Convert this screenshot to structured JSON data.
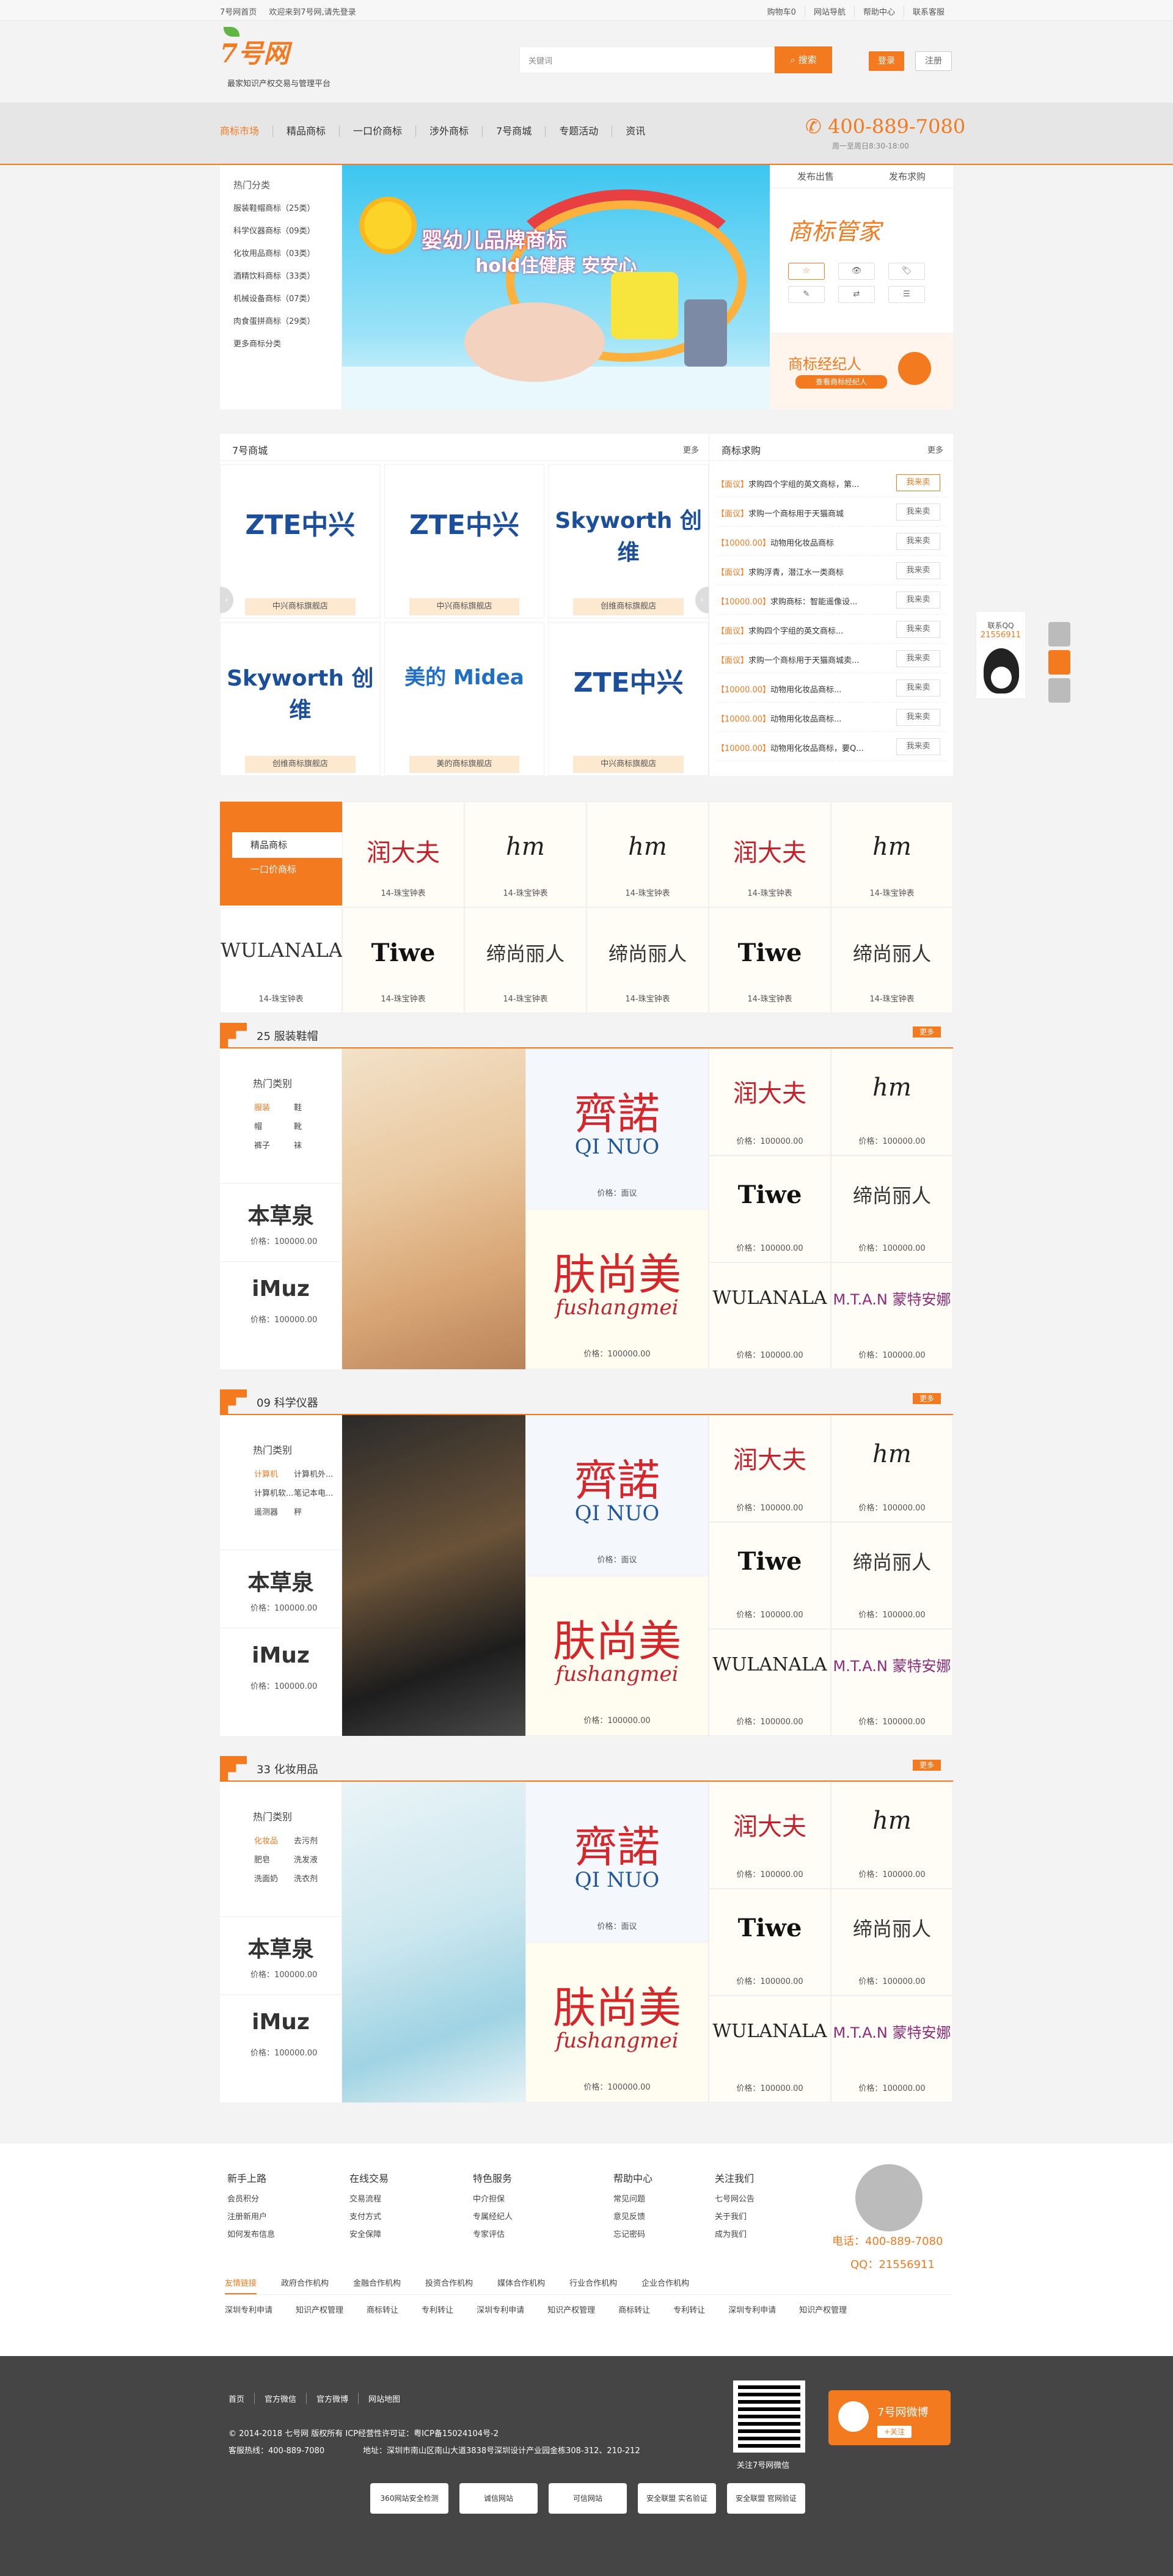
{
  "topbar": {
    "links_left": [
      "7号网首页",
      "欢迎来到7号网,请先登录"
    ],
    "links_right": [
      "购物车0",
      "网站导航",
      "帮助中心",
      "联系客服"
    ]
  },
  "header": {
    "logo": "7号网",
    "slogan": "最家知识产权交易与管理平台",
    "search_placeholder": "关键词",
    "search_btn": "搜索",
    "login": "登录",
    "register": "注册"
  },
  "nav": {
    "items": [
      "商标市场",
      "精品商标",
      "一口价商标",
      "涉外商标",
      "7号商城",
      "专题活动",
      "资讯"
    ],
    "phone": "400-889-7080",
    "hours": "周一至周日8:30-18:00"
  },
  "categories": {
    "title": "热门分类",
    "items": [
      "服装鞋帽商标（25类）",
      "科学仪器商标（09类）",
      "化妆用品商标（03类）",
      "酒精饮料商标（33类）",
      "机械设备商标（07类）",
      "肉食蛋拼商标（29类）",
      "更多商标分类"
    ]
  },
  "banner": {
    "l1": "婴幼儿品牌商标",
    "l2": "hold住健康 安安心"
  },
  "publish": {
    "tab1": "发布出售",
    "tab2": "发布求购",
    "logo": "商标管家",
    "icons": [
      "☆",
      "👁",
      "🏷",
      "✎",
      "⇄",
      "☰"
    ],
    "agent_title": "商标经纪人",
    "agent_btn": "查看商标经纪人"
  },
  "shop": {
    "title": "7号商城",
    "more": "更多",
    "items": [
      {
        "logo": "ZTE中兴",
        "caption": "中兴商标旗舰店"
      },
      {
        "logo": "ZTE中兴",
        "caption": "中兴商标旗舰店"
      },
      {
        "logo": "Skyworth 创维",
        "caption": "创维商标旗舰店"
      },
      {
        "logo": "Skyworth 创维",
        "caption": "创维商标旗舰店"
      },
      {
        "logo": "美的 Midea",
        "caption": "美的商标旗舰店"
      },
      {
        "logo": "ZTE中兴",
        "caption": "中兴商标旗舰店"
      }
    ]
  },
  "requests": {
    "title": "商标求购",
    "more": "更多",
    "rows": [
      {
        "tag": "【面议】",
        "text": "求购四个字组的英文商标，第...",
        "btn": "我来卖"
      },
      {
        "tag": "【面议】",
        "text": "求购一个商标用于天猫商城",
        "btn": "我来卖"
      },
      {
        "tag": "【10000.00】",
        "text": "动物用化妆品商标",
        "btn": "我来卖"
      },
      {
        "tag": "【面议】",
        "text": "求购浮青，潜江水一类商标",
        "btn": "我来卖"
      },
      {
        "tag": "【10000.00】",
        "text": "求购商标：智能遥像设...",
        "btn": "我来卖"
      },
      {
        "tag": "【面议】",
        "text": "求购四个字组的英文商标...",
        "btn": "我来卖"
      },
      {
        "tag": "【面议】",
        "text": "求购一个商标用于天猫商城卖...",
        "btn": "我来卖"
      },
      {
        "tag": "【10000.00】",
        "text": "动物用化妆品商标...",
        "btn": "我来卖"
      },
      {
        "tag": "【10000.00】",
        "text": "动物用化妆品商标...",
        "btn": "我来卖"
      },
      {
        "tag": "【10000.00】",
        "text": "动物用化妆品商标，要Q...",
        "btn": "我来卖"
      }
    ]
  },
  "float_qq": {
    "label": "联系QQ",
    "number": "21556911"
  },
  "boutique": {
    "tab1": "精品商标",
    "tab2": "一口价商标",
    "cells": [
      {
        "logo": "润大夫",
        "caption": "14-珠宝钟表"
      },
      {
        "logo": "hm",
        "caption": "14-珠宝钟表"
      },
      {
        "logo": "hm",
        "caption": "14-珠宝钟表"
      },
      {
        "logo": "润大夫",
        "caption": "14-珠宝钟表"
      },
      {
        "logo": "hm",
        "caption": "14-珠宝钟表"
      },
      {
        "logo": "WULANALA",
        "caption": "14-珠宝钟表"
      },
      {
        "logo": "Tiwe",
        "caption": "14-珠宝钟表"
      },
      {
        "logo": "缔尚丽人",
        "caption": "14-珠宝钟表"
      },
      {
        "logo": "缔尚丽人",
        "caption": "14-珠宝钟表"
      },
      {
        "logo": "Tiwe",
        "caption": "14-珠宝钟表"
      },
      {
        "logo": "缔尚丽人",
        "caption": "14-珠宝钟表"
      }
    ]
  },
  "floors": [
    {
      "num": "25",
      "title": "服装鞋帽",
      "more": "更多",
      "hot_title": "热门类别",
      "hot": [
        "服装",
        "鞋",
        "帽",
        "靴",
        "裤子",
        "袜"
      ],
      "mini": [
        {
          "logo": "本草泉",
          "price": "价格：100000.00"
        },
        {
          "logo": "iMuz",
          "price": "价格：100000.00"
        }
      ],
      "big": [
        {
          "logo": "齊諾",
          "sub": "QI NUO",
          "price": "价格：面议"
        },
        {
          "logo": "肤尚美",
          "sub": "fushangmei",
          "price": "价格：100000.00"
        }
      ],
      "small": [
        {
          "logo": "润大夫",
          "price": "价格：100000.00"
        },
        {
          "logo": "hm",
          "price": "价格：100000.00"
        },
        {
          "logo": "Tiwe",
          "price": "价格：100000.00"
        },
        {
          "logo": "缔尚丽人",
          "price": "价格：100000.00"
        },
        {
          "logo": "WULANALA",
          "price": "价格：100000.00"
        },
        {
          "logo": "M.T.A.N 蒙特安娜",
          "price": "价格：100000.00"
        }
      ]
    },
    {
      "num": "09",
      "title": "科学仪器",
      "more": "更多",
      "hot_title": "热门类别",
      "hot": [
        "计算机",
        "计算机外...",
        "计算机软...",
        "笔记本电...",
        "遥测器",
        "秤"
      ],
      "mini": [
        {
          "logo": "本草泉",
          "price": "价格：100000.00"
        },
        {
          "logo": "iMuz",
          "price": "价格：100000.00"
        }
      ],
      "big": [
        {
          "logo": "齊諾",
          "sub": "QI NUO",
          "price": "价格：面议"
        },
        {
          "logo": "肤尚美",
          "sub": "fushangmei",
          "price": "价格：100000.00"
        }
      ],
      "small": [
        {
          "logo": "润大夫",
          "price": "价格：100000.00"
        },
        {
          "logo": "hm",
          "price": "价格：100000.00"
        },
        {
          "logo": "Tiwe",
          "price": "价格：100000.00"
        },
        {
          "logo": "缔尚丽人",
          "price": "价格：100000.00"
        },
        {
          "logo": "WULANALA",
          "price": "价格：100000.00"
        },
        {
          "logo": "M.T.A.N 蒙特安娜",
          "price": "价格：100000.00"
        }
      ]
    },
    {
      "num": "33",
      "title": "化妆用品",
      "more": "更多",
      "hot_title": "热门类别",
      "hot": [
        "化妆品",
        "去污剂",
        "肥皂",
        "洗发液",
        "洗面奶",
        "洗衣剂"
      ],
      "mini": [
        {
          "logo": "本草泉",
          "price": "价格：100000.00"
        },
        {
          "logo": "iMuz",
          "price": "价格：100000.00"
        }
      ],
      "big": [
        {
          "logo": "齊諾",
          "sub": "QI NUO",
          "price": "价格：面议"
        },
        {
          "logo": "肤尚美",
          "sub": "fushangmei",
          "price": "价格：100000.00"
        }
      ],
      "small": [
        {
          "logo": "润大夫",
          "price": "价格：100000.00"
        },
        {
          "logo": "hm",
          "price": "价格：100000.00"
        },
        {
          "logo": "Tiwe",
          "price": "价格：100000.00"
        },
        {
          "logo": "缔尚丽人",
          "price": "价格：100000.00"
        },
        {
          "logo": "WULANALA",
          "price": "价格：100000.00"
        },
        {
          "logo": "M.T.A.N 蒙特安娜",
          "price": "价格：100000.00"
        }
      ]
    }
  ],
  "help": {
    "cols": [
      {
        "title": "新手上路",
        "items": [
          "会员积分",
          "注册新用户",
          "如何发布信息"
        ]
      },
      {
        "title": "在线交易",
        "items": [
          "交易流程",
          "支付方式",
          "安全保障"
        ]
      },
      {
        "title": "特色服务",
        "items": [
          "中介担保",
          "专属经纪人",
          "专家评估"
        ]
      },
      {
        "title": "帮助中心",
        "items": [
          "常见问题",
          "意见反馈",
          "忘记密码"
        ]
      },
      {
        "title": "关注我们",
        "items": [
          "七号网公告",
          "关于我们",
          "成为我们"
        ]
      }
    ],
    "phone": "电话：400-889-7080",
    "qq": "QQ：21556911",
    "links1": [
      "友情链接",
      "政府合作机构",
      "金融合作机构",
      "投资合作机构",
      "媒体合作机构",
      "行业合作机构",
      "企业合作机构"
    ],
    "links2": [
      "深圳专利申请",
      "知识产权管理",
      "商标转让",
      "专利转让",
      "深圳专利申请",
      "知识产权管理",
      "商标转让",
      "专利转让",
      "深圳专利申请",
      "知识产权管理"
    ]
  },
  "footer": {
    "nav": [
      "首页",
      "官方微信",
      "官方微博",
      "网站地图"
    ],
    "copy1": "© 2014-2018 七号网 版权所有 ICP经营性许可证：粤ICP备15024104号-2",
    "copy2": "客服热线：400-889-7080",
    "copy3": "地址：深圳市南山区南山大道3838号深圳设计产业园金栋308-312、210-212",
    "qr_caption": "关注7号网微信",
    "weibo": "7号网微博",
    "follow": "+关注",
    "badges": [
      "360网站安全检测",
      "诚信网站",
      "可信网站",
      "安全联盟 实名验证",
      "安全联盟 官网验证"
    ]
  }
}
